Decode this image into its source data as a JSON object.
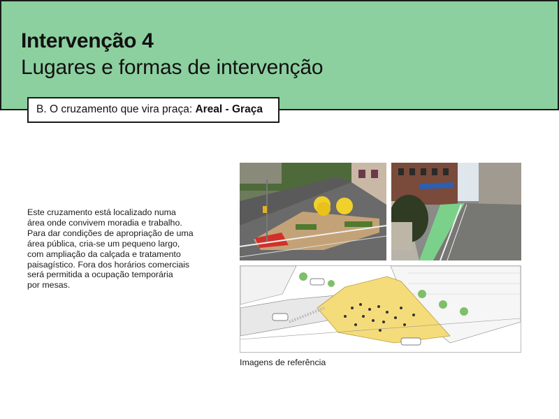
{
  "header": {
    "title": "Intervenção 4",
    "subtitle": "Lugares e formas de intervenção"
  },
  "section": {
    "prefix": "B. O cruzamento que vira praça: ",
    "highlight": "Areal - Graça"
  },
  "description": {
    "lines": [
      "Este cruzamento está localizado numa",
      "área onde convivem moradia e trabalho.",
      "Para dar condições de apropriação de uma",
      "área pública, cria-se um pequeno largo,",
      "com ampliação da calçada e tratamento",
      "paisagístico. Fora dos horários comerciais",
      "será permitida a ocupação temporária",
      "por mesas."
    ]
  },
  "images": {
    "caption": "Imagens de referência"
  },
  "colors": {
    "header_bg": "#8dd0a0",
    "plaza_yellow": "#f5dc7a",
    "plaza_red": "#d9302a",
    "bike_green": "#7bd18a"
  }
}
